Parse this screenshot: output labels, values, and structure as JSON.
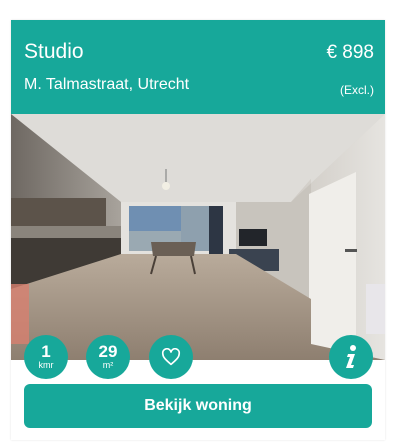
{
  "listing": {
    "title": "Studio",
    "price": "€ 898",
    "address": "M. Talmastraat, Utrecht",
    "price_note": "(Excl.)"
  },
  "features": {
    "rooms_value": "1",
    "rooms_unit": "kmr",
    "area_value": "29",
    "area_unit": "m²"
  },
  "icons": {
    "favorite": "heart-icon",
    "info": "info-icon"
  },
  "actions": {
    "view_label": "Bekijk woning"
  },
  "colors": {
    "accent": "#17a89a"
  }
}
